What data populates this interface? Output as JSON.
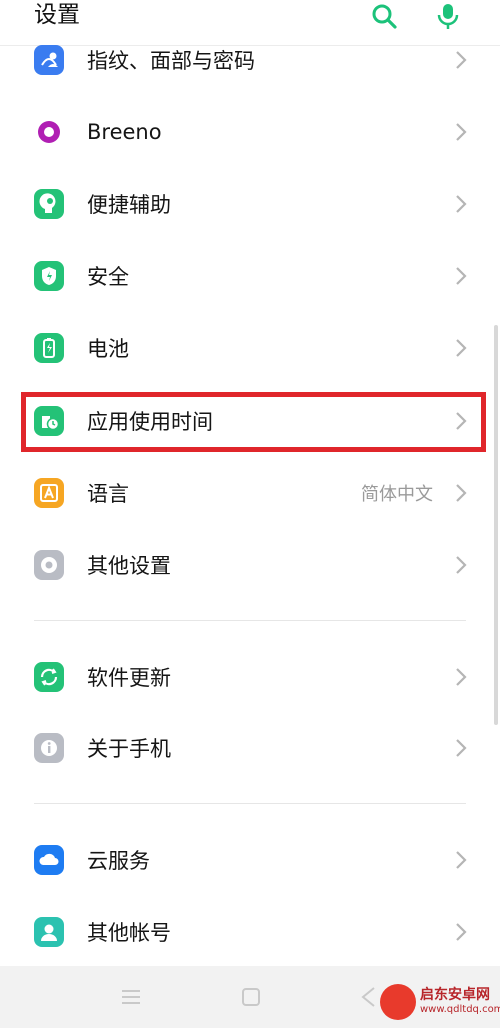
{
  "header": {
    "title": "设置",
    "search_icon": "search-icon",
    "mic_icon": "microphone-icon",
    "accent_color": "#1cc27a"
  },
  "rows": [
    {
      "label": "指纹、面部与密码",
      "icon": "fingerprint-face-icon",
      "color": "#3a7cf0"
    },
    {
      "label": "Breeno",
      "icon": "breeno-icon",
      "color": "#ffffff"
    },
    {
      "label": "便捷辅助",
      "icon": "assist-icon",
      "color": "#24c277"
    },
    {
      "label": "安全",
      "icon": "shield-icon",
      "color": "#24c277"
    },
    {
      "label": "电池",
      "icon": "battery-icon",
      "color": "#24c277"
    },
    {
      "label": "应用使用时间",
      "icon": "app-usage-time-icon",
      "color": "#24c277"
    },
    {
      "label": "语言",
      "value": "简体中文",
      "icon": "language-icon",
      "color": "#f6a623"
    },
    {
      "label": "其他设置",
      "icon": "other-settings-icon",
      "color": "#b9bcc4"
    },
    {
      "label": "软件更新",
      "icon": "software-update-icon",
      "color": "#24c277"
    },
    {
      "label": "关于手机",
      "icon": "about-phone-icon",
      "color": "#b9bcc4"
    },
    {
      "label": "云服务",
      "icon": "cloud-icon",
      "color": "#1e7cf2"
    },
    {
      "label": "其他帐号",
      "icon": "account-icon",
      "color": "#2bc2b0"
    }
  ],
  "highlight_color": "#e0262b",
  "watermark": {
    "text": "启东安卓网",
    "url": "www.qdltdq.com"
  }
}
